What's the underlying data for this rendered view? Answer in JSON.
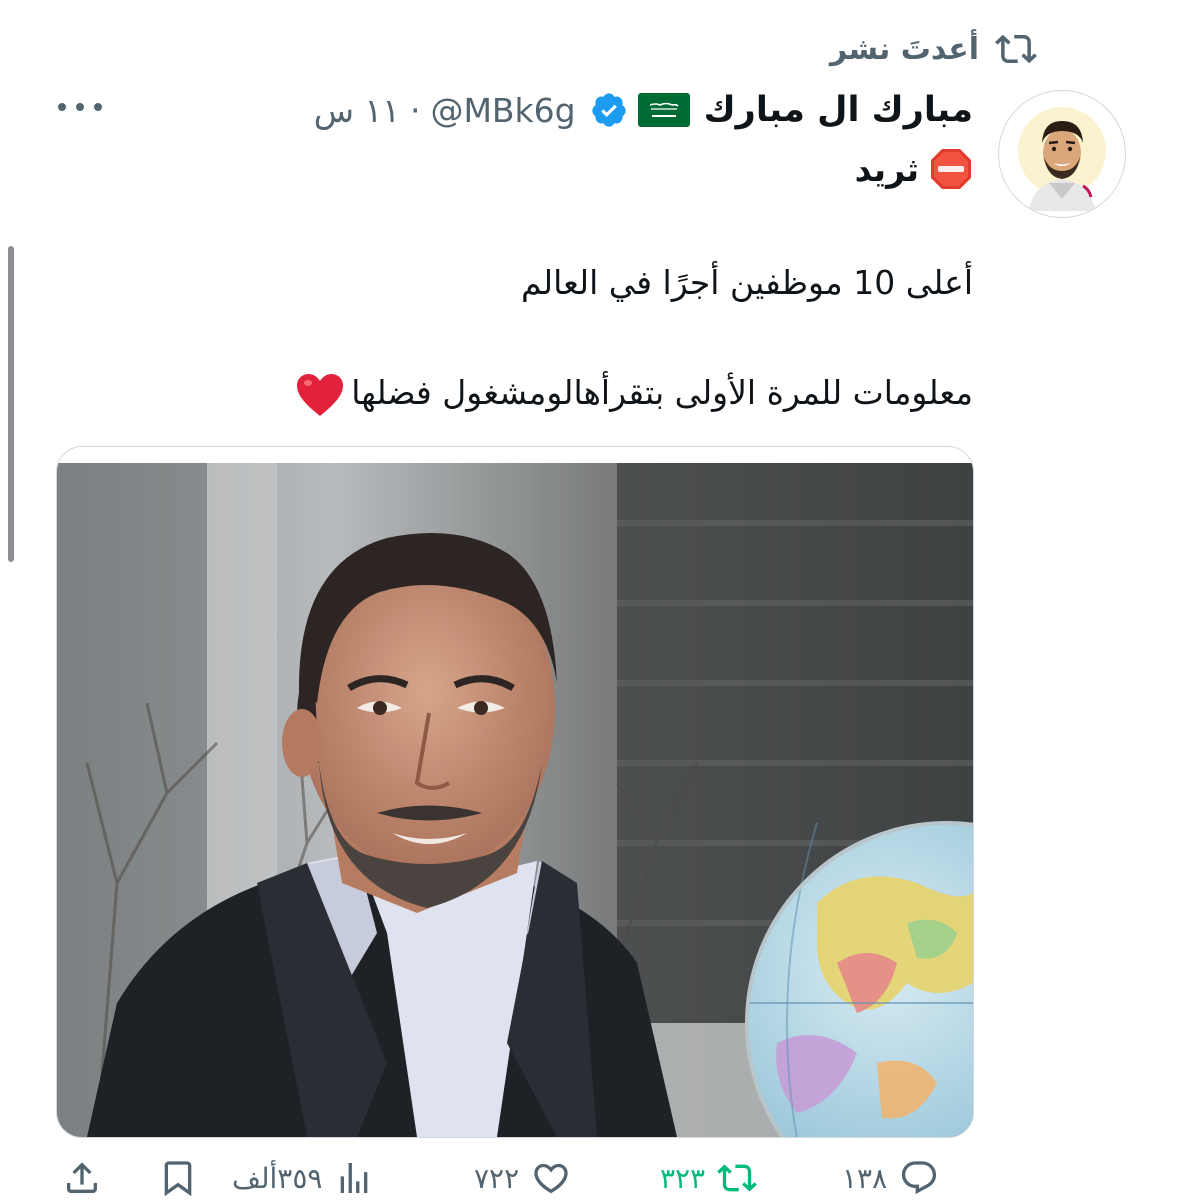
{
  "retweet": {
    "label": "أعدتَ نشر",
    "icon": "retweet-icon"
  },
  "author": {
    "display_name": "مبارك ال مبارك",
    "flag_icon": "saudi-flag-icon",
    "verified_icon": "verified-badge-icon",
    "handle": "MBk6g@",
    "separator": "·",
    "time": "١١ س",
    "avatar_icon": "avatar-cartoon-man"
  },
  "thread": {
    "label": "ثريد",
    "icon": "stop-sign-icon"
  },
  "tweet": {
    "line1": "أعلى 10 موظفين أجرًا في العالم",
    "line2": "معلومات للمرة الأولى بتقرأهالومشغول فضلها",
    "heart_icon": "red-heart-icon"
  },
  "media": {
    "description_icon": "photo-man-with-globe"
  },
  "actions": {
    "replies": "١٣٨",
    "retweets": "٣٢٣",
    "likes": "٧٢٢",
    "views": "٣٥٩ألف",
    "reply_icon": "reply-icon",
    "retweet_icon": "retweet-icon",
    "like_icon": "like-heart-icon",
    "views_icon": "analytics-bars-icon",
    "bookmark_icon": "bookmark-icon",
    "share_icon": "share-icon"
  },
  "colors": {
    "text": "#0f1419",
    "secondary": "#536471",
    "retweet_green": "#00ba7c",
    "verified_blue": "#1d9bf0",
    "heart_red": "#e0245e"
  }
}
